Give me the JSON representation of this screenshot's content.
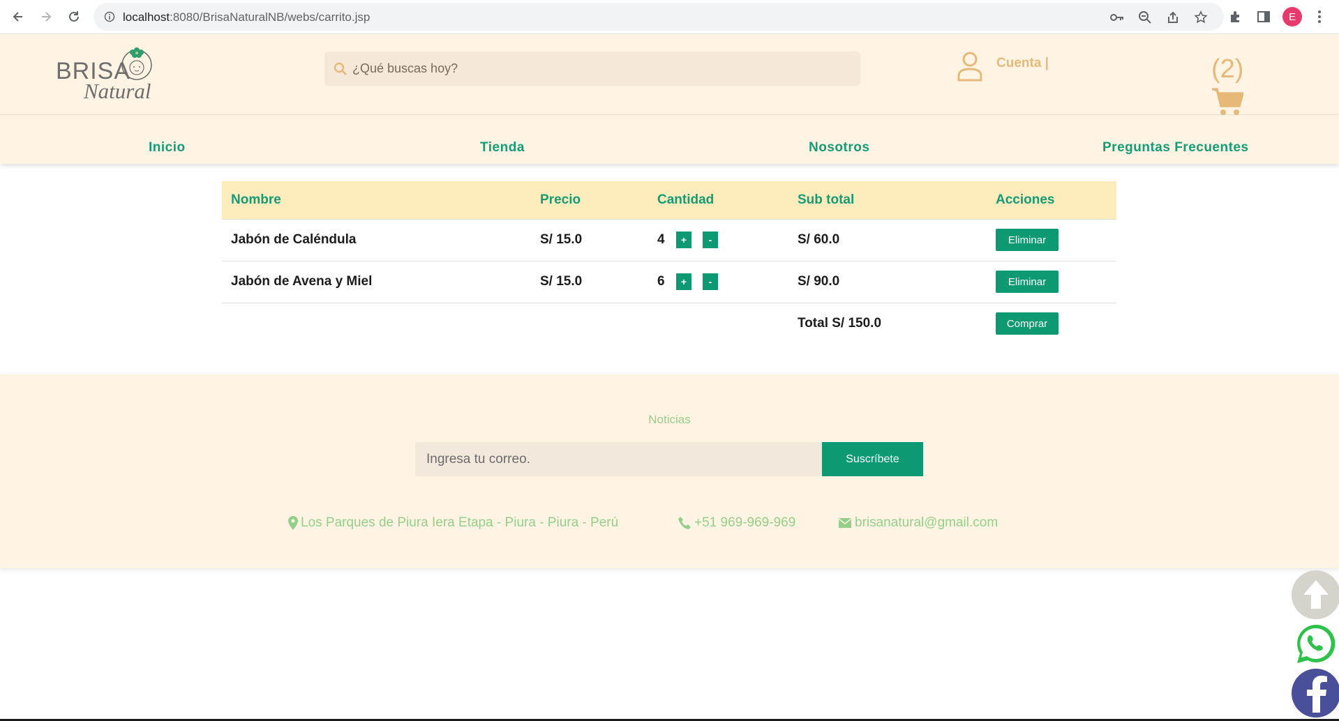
{
  "browser": {
    "url_host": "localhost",
    "url_path": ":8080/BrisaNaturalNB/webs/carrito.jsp",
    "profile_initial": "E"
  },
  "header": {
    "logo_word1": "BRISA",
    "logo_word2": "Natural",
    "search_placeholder": "¿Qué buscas hoy?",
    "account_label": "Cuenta |",
    "cart_count": "(2)"
  },
  "nav": {
    "items": [
      "Inicio",
      "Tienda",
      "Nosotros",
      "Preguntas Frecuentes"
    ]
  },
  "cart": {
    "columns": [
      "Nombre",
      "Precio",
      "Cantidad",
      "Sub total",
      "Acciones"
    ],
    "rows": [
      {
        "name": "Jabón de Caléndula",
        "price": "S/ 15.0",
        "qty": "4",
        "subtotal": "S/ 60.0",
        "action": "Eliminar"
      },
      {
        "name": "Jabón de Avena y Miel",
        "price": "S/ 15.0",
        "qty": "6",
        "subtotal": "S/ 90.0",
        "action": "Eliminar"
      }
    ],
    "plus_label": "+",
    "minus_label": "-",
    "total_label": "Total S/ 150.0",
    "buy_label": "Comprar"
  },
  "footer": {
    "title": "Noticias",
    "email_placeholder": "Ingresa tu correo.",
    "subscribe_label": "Suscríbete",
    "address": "Los Parques de Piura Iera Etapa - Piura - Piura - Perú",
    "phone": "+51 969-969-969",
    "email": "brisanatural@gmail.com"
  },
  "colors": {
    "brand_green": "#0d9a73",
    "header_bg": "#fff4e3",
    "accent_gold": "#e6b978",
    "table_head_bg": "#ffecbd",
    "footer_text_green": "#93cf8a"
  }
}
